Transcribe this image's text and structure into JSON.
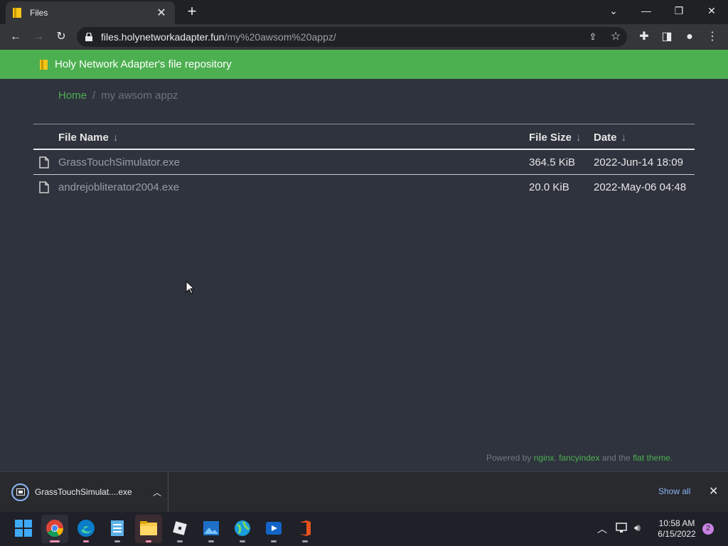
{
  "browser": {
    "tab_title": "Files",
    "url_host": "files.holynetworkadapter.fun",
    "url_path": "/my%20awsom%20appz/"
  },
  "banner": {
    "title": "Holy Network Adapter's file repository"
  },
  "breadcrumb": {
    "home": "Home",
    "separator": "/",
    "current": "my awsom appz"
  },
  "table": {
    "headers": {
      "name": "File Name",
      "size": "File Size",
      "date": "Date",
      "sort_arrow": "↓"
    },
    "rows": [
      {
        "name": "GrassTouchSimulator.exe",
        "size": "364.5 KiB",
        "date": "2022-Jun-14 18:09"
      },
      {
        "name": "andrejobliterator2004.exe",
        "size": "20.0 KiB",
        "date": "2022-May-06 04:48"
      }
    ]
  },
  "footer": {
    "prefix": "Powered by",
    "nginx": "nginx",
    "comma": ",",
    "fancyindex": "fancyindex",
    "and_the": "and the",
    "theme": "flat theme",
    "period": "."
  },
  "downloads": {
    "item_name": "GrassTouchSimulat....exe",
    "show_all": "Show all"
  },
  "taskbar": {
    "time": "10:58 AM",
    "date": "6/15/2022",
    "notifications": "2"
  },
  "colors": {
    "accent": "#4caf50",
    "page_bg": "#2f333d"
  }
}
